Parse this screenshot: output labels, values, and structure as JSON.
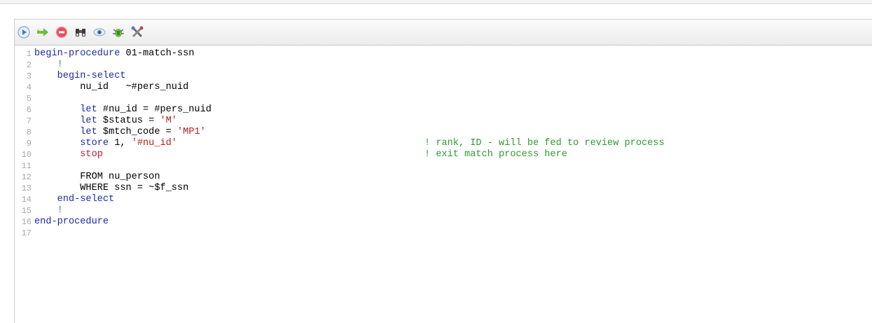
{
  "toolbar": {
    "buttons": [
      {
        "name": "run-icon",
        "label": "run"
      },
      {
        "name": "step-arrow-icon",
        "label": "step"
      },
      {
        "name": "stop-icon",
        "label": "stop"
      },
      {
        "name": "binoculars-icon",
        "label": "find"
      },
      {
        "name": "eye-icon",
        "label": "watch"
      },
      {
        "name": "debug-bug-icon",
        "label": "debug"
      },
      {
        "name": "tools-icon",
        "label": "tools"
      }
    ]
  },
  "editor": {
    "line_numbers": [
      "1",
      "2",
      "3",
      "4",
      "5",
      "6",
      "7",
      "8",
      "9",
      "10",
      "11",
      "12",
      "13",
      "14",
      "15",
      "16",
      "17"
    ],
    "lines": {
      "l1": {
        "kw": "begin-procedure",
        "txt": " 01-match-ssn"
      },
      "l2": {
        "indent": "    ",
        "bang": "!"
      },
      "l3": {
        "indent": "    ",
        "kw": "begin-select"
      },
      "l4": {
        "indent": "        ",
        "txt": "nu_id   ~#pers_nuid"
      },
      "l6": {
        "indent": "        ",
        "kw": "let",
        "txt": " #nu_id = #pers_nuid"
      },
      "l7": {
        "indent": "        ",
        "kw": "let",
        "txt": " $status = ",
        "str": "'M'"
      },
      "l8": {
        "indent": "        ",
        "kw": "let",
        "txt": " $mtch_code = ",
        "str": "'MP1'"
      },
      "l9": {
        "indent": "        ",
        "kw": "store",
        "txt": " 1, ",
        "str": "'#nu_id'",
        "comment": "! rank, ID - will be fed to review process"
      },
      "l10": {
        "indent": "        ",
        "red": "stop",
        "comment": "! exit match process here"
      },
      "l12": {
        "indent": "        ",
        "txt": "FROM nu_person"
      },
      "l13": {
        "indent": "        ",
        "txt": "WHERE ssn = ~$f_ssn"
      },
      "l14": {
        "indent": "    ",
        "kw": "end-select"
      },
      "l15": {
        "indent": "    ",
        "bang": "!"
      },
      "l16": {
        "kw": "end-procedure"
      }
    }
  },
  "colors": {
    "keyword": "#1c2aa8",
    "string": "#b22222",
    "stop_keyword": "#c0172c",
    "comment": "#2f9a2f",
    "line_number": "#a8a8a8"
  }
}
